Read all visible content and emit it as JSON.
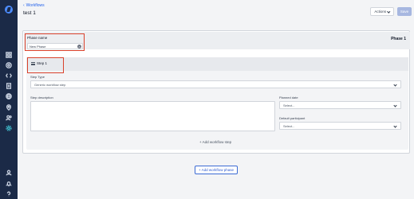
{
  "breadcrumb": {
    "chevron": "‹",
    "label": "Workflows"
  },
  "page": {
    "title": "test 1"
  },
  "toolbar": {
    "actions_label": "Actions",
    "save_label": "Save"
  },
  "phase": {
    "number_label": "Phase 1",
    "name_label": "Phase name",
    "name_value": "New Phase"
  },
  "step": {
    "title": "Step 1",
    "step_type_label": "Step Type",
    "step_type_value": "Generic workflow step",
    "description_label": "Step description",
    "planned_date_label": "Planned date",
    "planned_date_placeholder": "Select...",
    "default_participant_label": "Default participant",
    "default_participant_placeholder": "Select..."
  },
  "add_step_label": "+ Add workflow step",
  "add_phase_label": "+ Add workflow phase",
  "colors": {
    "sidebar": "#1b2a47",
    "accent": "#2563eb",
    "highlight": "#d9412b"
  }
}
